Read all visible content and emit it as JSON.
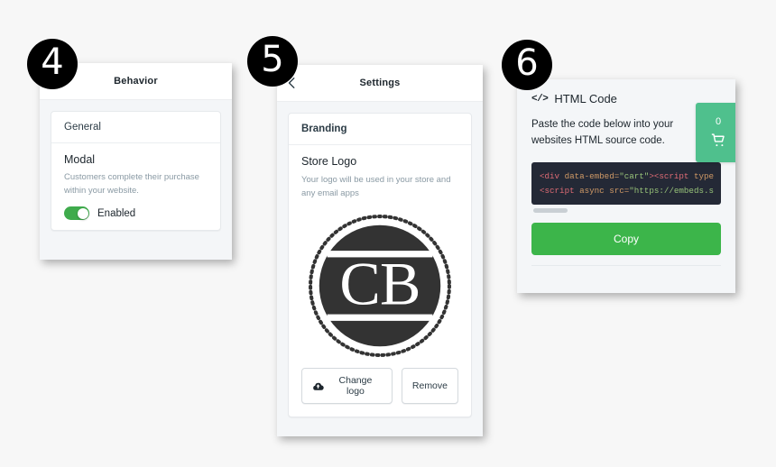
{
  "steps": [
    {
      "number": "4",
      "panel": "behavior"
    },
    {
      "number": "5",
      "panel": "settings"
    },
    {
      "number": "6",
      "panel": "html-code"
    }
  ],
  "panel_behavior": {
    "header_title": "Behavior",
    "general_label": "General",
    "modal_title": "Modal",
    "modal_description": "Customers complete their purchase within your website.",
    "toggle_label": "Enabled",
    "toggle_state": "on",
    "toggle_color": "#3fab4c"
  },
  "panel_settings": {
    "header_title": "Settings",
    "back_icon": "back-arrow-icon",
    "branding_label": "Branding",
    "store_logo_title": "Store Logo",
    "store_logo_description": "Your logo will be used in your store and any email apps",
    "logo_text": "CB",
    "change_logo_label": "Change logo",
    "change_logo_icon": "cloud-upload-icon",
    "remove_label": "Remove"
  },
  "panel_html_code": {
    "icon": "code-brackets-icon",
    "title": "HTML Code",
    "description": "Paste the code below into your websites HTML source code.",
    "cart_widget": {
      "count": "0",
      "icon": "shopping-cart-icon",
      "color": "#4fc08d"
    },
    "code_lines": [
      [
        {
          "t": "tag",
          "v": "<div"
        },
        {
          "t": "attr",
          "v": " data-embed="
        },
        {
          "t": "str",
          "v": "\"cart\""
        },
        {
          "t": "tag",
          "v": "><script"
        },
        {
          "t": "attr",
          "v": " type"
        }
      ],
      [
        {
          "t": "tag",
          "v": "<script"
        },
        {
          "t": "attr",
          "v": " async src="
        },
        {
          "t": "str",
          "v": "\"https://embeds.s"
        }
      ]
    ],
    "copy_label": "Copy",
    "code_bg": "#242936",
    "copy_color": "#3cb54a"
  }
}
